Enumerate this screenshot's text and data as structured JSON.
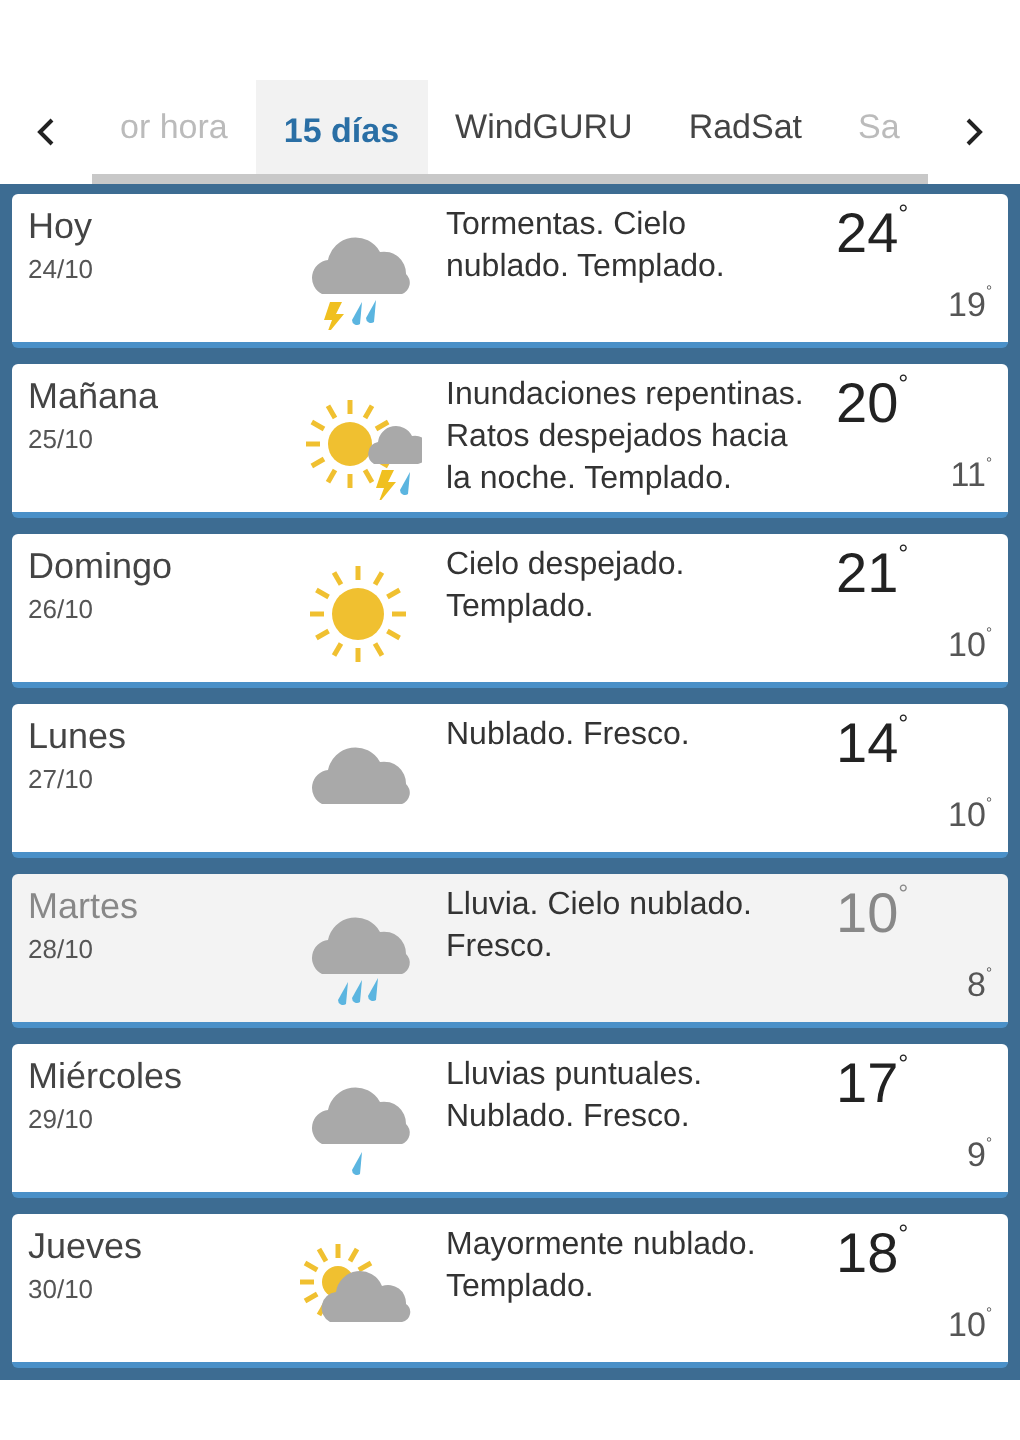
{
  "tabs": [
    {
      "label": "or hora",
      "selected": false
    },
    {
      "label": "15 días",
      "selected": true
    },
    {
      "label": "WindGURU",
      "selected": false
    },
    {
      "label": "RadSat",
      "selected": false
    },
    {
      "label": "Sa",
      "selected": false
    }
  ],
  "days": [
    {
      "day": "Hoy",
      "date": "24/10",
      "kind": "storm",
      "description": "Tormentas. Cielo nublado. Templado.",
      "high": "24$^{°}$",
      "low": "19$^{°}$",
      "selected": false
    },
    {
      "day": "Mañana",
      "date": "25/10",
      "kind": "sun-storm",
      "description": "Inundaciones repentinas. Ratos despejados hacia la noche. Templado.",
      "high": "20$^{°}$",
      "low": "11$^{°}$",
      "selected": false
    },
    {
      "day": "Domingo",
      "date": "26/10",
      "kind": "sun",
      "description": "Cielo despejado. Templado.",
      "high": "21$^{°}$",
      "low": "10$^{°}$",
      "selected": false
    },
    {
      "day": "Lunes",
      "date": "27/10",
      "kind": "cloud",
      "description": "Nublado. Fresco.",
      "high": "14$^{°}$",
      "low": "10$^{°}$",
      "selected": false
    },
    {
      "day": "Martes",
      "date": "28/10",
      "kind": "rain",
      "description": "Lluvia. Cielo nublado. Fresco.",
      "high": "10$^{°}$",
      "low": "8$^{°}$",
      "selected": true
    },
    {
      "day": "Miércoles",
      "date": "29/10",
      "kind": "showers",
      "description": "Lluvias puntuales. Nublado. Fresco.",
      "high": "17$^{°}$",
      "low": "9$^{°}$",
      "selected": false
    },
    {
      "day": "Jueves",
      "date": "30/10",
      "kind": "sun-cloud",
      "description": "Mayormente nublado. Templado.",
      "high": "18$^{°}$",
      "low": "10$^{°}$",
      "selected": false
    }
  ]
}
